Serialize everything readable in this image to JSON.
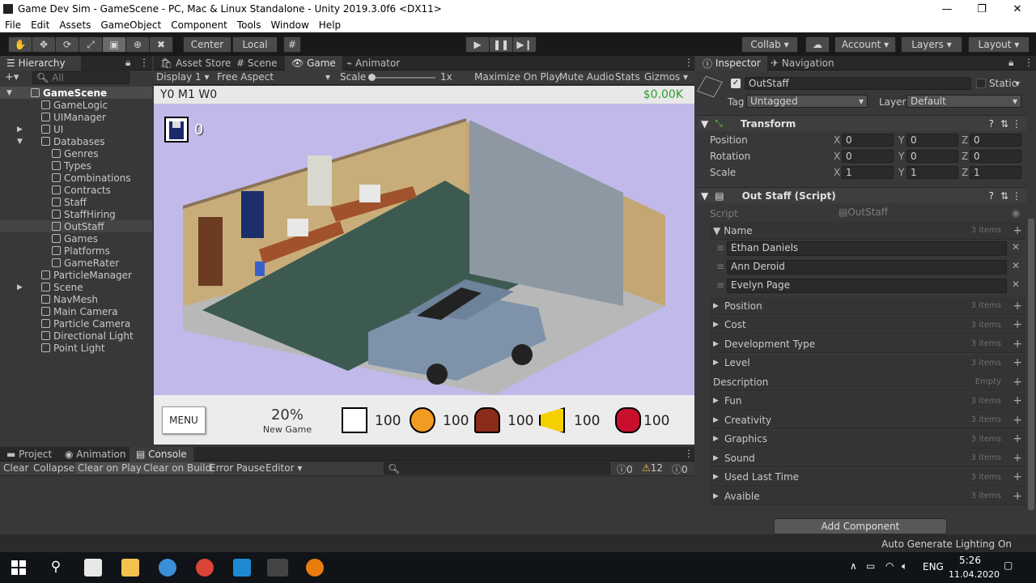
{
  "window": {
    "title": "Game Dev Sim - GameScene - PC, Mac & Linux Standalone - Unity 2019.3.0f6 <DX11>"
  },
  "menu": [
    "File",
    "Edit",
    "Assets",
    "GameObject",
    "Component",
    "Tools",
    "Window",
    "Help"
  ],
  "toolbar": {
    "center_label": "Center",
    "local_label": "Local",
    "collab_label": "Collab ▾",
    "account_label": "Account",
    "layers_label": "Layers",
    "layout_label": "Layout"
  },
  "hierarchy": {
    "tab": "Hierarchy",
    "search_placeholder": "All",
    "items": [
      {
        "label": "GameScene",
        "depth": 0,
        "arrow": "▼",
        "selected": true
      },
      {
        "label": "GameLogic",
        "depth": 1,
        "arrow": ""
      },
      {
        "label": "UIManager",
        "depth": 1,
        "arrow": ""
      },
      {
        "label": "UI",
        "depth": 1,
        "arrow": "▶"
      },
      {
        "label": "Databases",
        "depth": 1,
        "arrow": "▼"
      },
      {
        "label": "Genres",
        "depth": 2,
        "arrow": ""
      },
      {
        "label": "Types",
        "depth": 2,
        "arrow": ""
      },
      {
        "label": "Combinations",
        "depth": 2,
        "arrow": ""
      },
      {
        "label": "Contracts",
        "depth": 2,
        "arrow": ""
      },
      {
        "label": "Staff",
        "depth": 2,
        "arrow": ""
      },
      {
        "label": "StaffHiring",
        "depth": 2,
        "arrow": ""
      },
      {
        "label": "OutStaff",
        "depth": 2,
        "arrow": "",
        "highlight": true
      },
      {
        "label": "Games",
        "depth": 2,
        "arrow": ""
      },
      {
        "label": "Platforms",
        "depth": 2,
        "arrow": ""
      },
      {
        "label": "GameRater",
        "depth": 2,
        "arrow": ""
      },
      {
        "label": "ParticleManager",
        "depth": 1,
        "arrow": ""
      },
      {
        "label": "Scene",
        "depth": 1,
        "arrow": "▶"
      },
      {
        "label": "NavMesh",
        "depth": 1,
        "arrow": ""
      },
      {
        "label": "Main Camera",
        "depth": 1,
        "arrow": ""
      },
      {
        "label": "Particle Camera",
        "depth": 1,
        "arrow": ""
      },
      {
        "label": "Directional Light",
        "depth": 1,
        "arrow": ""
      },
      {
        "label": "Point Light",
        "depth": 1,
        "arrow": ""
      }
    ]
  },
  "center_tabs": [
    "Asset Store",
    "Scene",
    "Game",
    "Animator"
  ],
  "game_bar": {
    "display": "Display 1",
    "aspect": "Free Aspect",
    "scale_label": "Scale",
    "scale_value": "1x",
    "maximize": "Maximize On Play",
    "mute": "Mute Audio",
    "stats": "Stats",
    "gizmos": "Gizmos"
  },
  "game": {
    "date": "Y0 M1 W0",
    "money": "$0.00K",
    "disk_count": "0",
    "menu_button": "MENU",
    "progress_pct": "20%",
    "progress_label": "New Game",
    "stats": [
      {
        "icon": "controller-icon",
        "value": "100"
      },
      {
        "icon": "fire-icon",
        "value": "100"
      },
      {
        "icon": "helmet-icon",
        "value": "100"
      },
      {
        "icon": "horn-icon",
        "value": "100"
      },
      {
        "icon": "bug-icon",
        "value": "100"
      }
    ],
    "colors": {
      "sky": "#c1b9e9",
      "wall": "#c8ad7a",
      "floor": "#3d5a50",
      "car": "#7e93aa"
    }
  },
  "inspector": {
    "tab": "Inspector",
    "nav_tab": "Navigation",
    "object_name": "OutStaff",
    "static_label": "Static",
    "tag_label": "Tag",
    "tag_value": "Untagged",
    "layer_label": "Layer",
    "layer_value": "Default",
    "transform": {
      "title": "Transform",
      "rows": [
        {
          "label": "Position",
          "x": "0",
          "y": "0",
          "z": "0"
        },
        {
          "label": "Rotation",
          "x": "0",
          "y": "0",
          "z": "0"
        },
        {
          "label": "Scale",
          "x": "1",
          "y": "1",
          "z": "1"
        }
      ]
    },
    "script_comp": {
      "title": "Out Staff (Script)",
      "script_label": "Script",
      "script_value": "OutStaff"
    },
    "name_list": {
      "label": "Name",
      "count": "3 items",
      "values": [
        "Ethan Daniels",
        "Ann Deroid",
        "Evelyn Page"
      ]
    },
    "fields": [
      {
        "label": "Position",
        "count": "3 items"
      },
      {
        "label": "Cost",
        "count": "3 items"
      },
      {
        "label": "Development Type",
        "count": "3 items"
      },
      {
        "label": "Level",
        "count": "3 items"
      },
      {
        "label": "Description",
        "count": "Empty"
      },
      {
        "label": "Fun",
        "count": "3 items"
      },
      {
        "label": "Creativity",
        "count": "3 items"
      },
      {
        "label": "Graphics",
        "count": "3 items"
      },
      {
        "label": "Sound",
        "count": "3 items"
      },
      {
        "label": "Used Last Time",
        "count": "3 items"
      },
      {
        "label": "Avaible",
        "count": "3 items"
      }
    ],
    "add_component": "Add Component"
  },
  "console": {
    "tabs": [
      "Project",
      "Animation",
      "Console"
    ],
    "buttons": [
      "Clear",
      "Collapse",
      "Clear on Play",
      "Clear on Build",
      "Error Pause",
      "Editor ▾"
    ],
    "info_count": "0",
    "warn_count": "12",
    "err_count": "0"
  },
  "status": {
    "text": "Auto Generate Lighting On"
  },
  "taskbar": {
    "lang": "ENG",
    "time": "5:26",
    "date": "11.04.2020"
  }
}
